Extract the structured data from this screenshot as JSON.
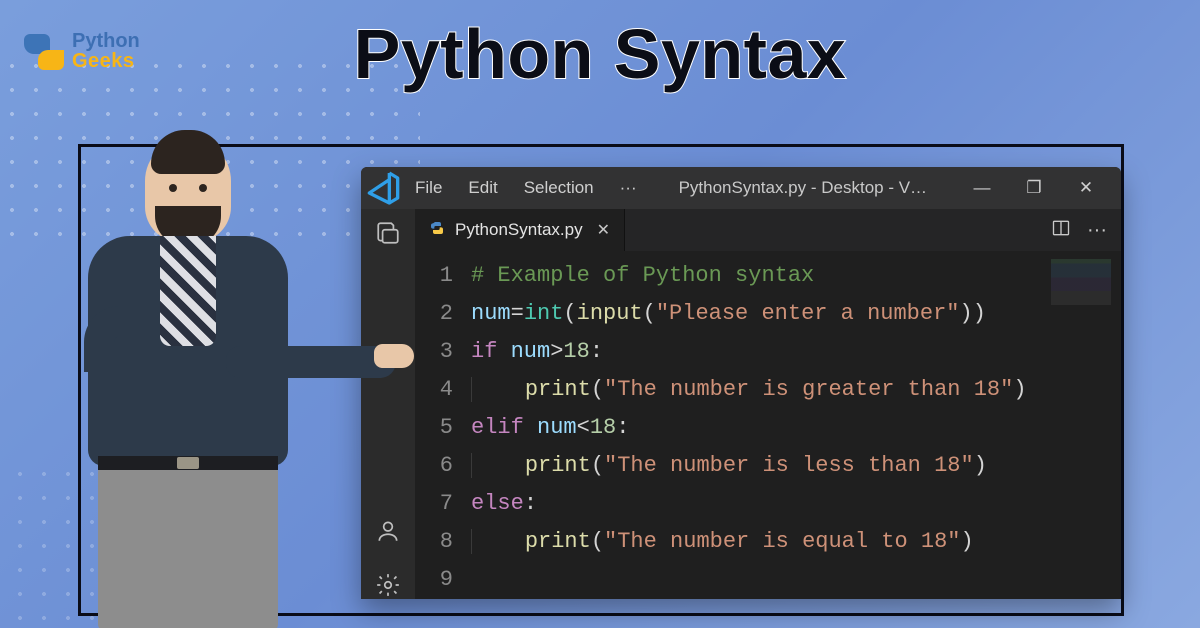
{
  "logo": {
    "line1": "Python",
    "line2": "Geeks"
  },
  "heading": "Python Syntax",
  "titlebar": {
    "menus": [
      "File",
      "Edit",
      "Selection"
    ],
    "ellipsis": "···",
    "window_title": "PythonSyntax.py - Desktop - V…",
    "buttons": {
      "minimize": "—",
      "maximize": "❐",
      "close": "✕"
    }
  },
  "tabs": {
    "active": {
      "filename": "PythonSyntax.py",
      "close": "✕"
    }
  },
  "activity_icons": [
    "files-icon",
    "account-icon",
    "settings-gear-icon"
  ],
  "code": {
    "lines": [
      "# Example of Python syntax",
      "num=int(input(\"Please enter a number\"))",
      "if num>18:",
      "    print(\"The number is greater than 18\")",
      "elif num<18:",
      "    print(\"The number is less than 18\")",
      "else:",
      "    print(\"The number is equal to 18\")",
      ""
    ],
    "tokens": [
      [
        {
          "t": "# Example of Python syntax",
          "c": "comment"
        }
      ],
      [
        {
          "t": "num",
          "c": "var"
        },
        {
          "t": "=",
          "c": "op"
        },
        {
          "t": "int",
          "c": "builtin"
        },
        {
          "t": "(",
          "c": "punc"
        },
        {
          "t": "input",
          "c": "fn"
        },
        {
          "t": "(",
          "c": "punc"
        },
        {
          "t": "\"Please enter a number\"",
          "c": "str"
        },
        {
          "t": ")",
          "c": "punc"
        },
        {
          "t": ")",
          "c": "punc"
        }
      ],
      [
        {
          "t": "if",
          "c": "kw"
        },
        {
          "t": " ",
          "c": "punc"
        },
        {
          "t": "num",
          "c": "var"
        },
        {
          "t": ">",
          "c": "op"
        },
        {
          "t": "18",
          "c": "num"
        },
        {
          "t": ":",
          "c": "punc"
        }
      ],
      [
        {
          "t": "    ",
          "c": "punc",
          "guide": true
        },
        {
          "t": "print",
          "c": "fn"
        },
        {
          "t": "(",
          "c": "punc"
        },
        {
          "t": "\"The number is greater than 18\"",
          "c": "str"
        },
        {
          "t": ")",
          "c": "punc"
        }
      ],
      [
        {
          "t": "elif",
          "c": "kw"
        },
        {
          "t": " ",
          "c": "punc"
        },
        {
          "t": "num",
          "c": "var"
        },
        {
          "t": "<",
          "c": "op"
        },
        {
          "t": "18",
          "c": "num"
        },
        {
          "t": ":",
          "c": "punc"
        }
      ],
      [
        {
          "t": "    ",
          "c": "punc",
          "guide": true
        },
        {
          "t": "print",
          "c": "fn"
        },
        {
          "t": "(",
          "c": "punc"
        },
        {
          "t": "\"The number is less than 18\"",
          "c": "str"
        },
        {
          "t": ")",
          "c": "punc"
        }
      ],
      [
        {
          "t": "else",
          "c": "kw"
        },
        {
          "t": ":",
          "c": "punc"
        }
      ],
      [
        {
          "t": "    ",
          "c": "punc",
          "guide": true
        },
        {
          "t": "print",
          "c": "fn"
        },
        {
          "t": "(",
          "c": "punc"
        },
        {
          "t": "\"The number is equal to 18\"",
          "c": "str"
        },
        {
          "t": ")",
          "c": "punc"
        }
      ],
      []
    ]
  }
}
